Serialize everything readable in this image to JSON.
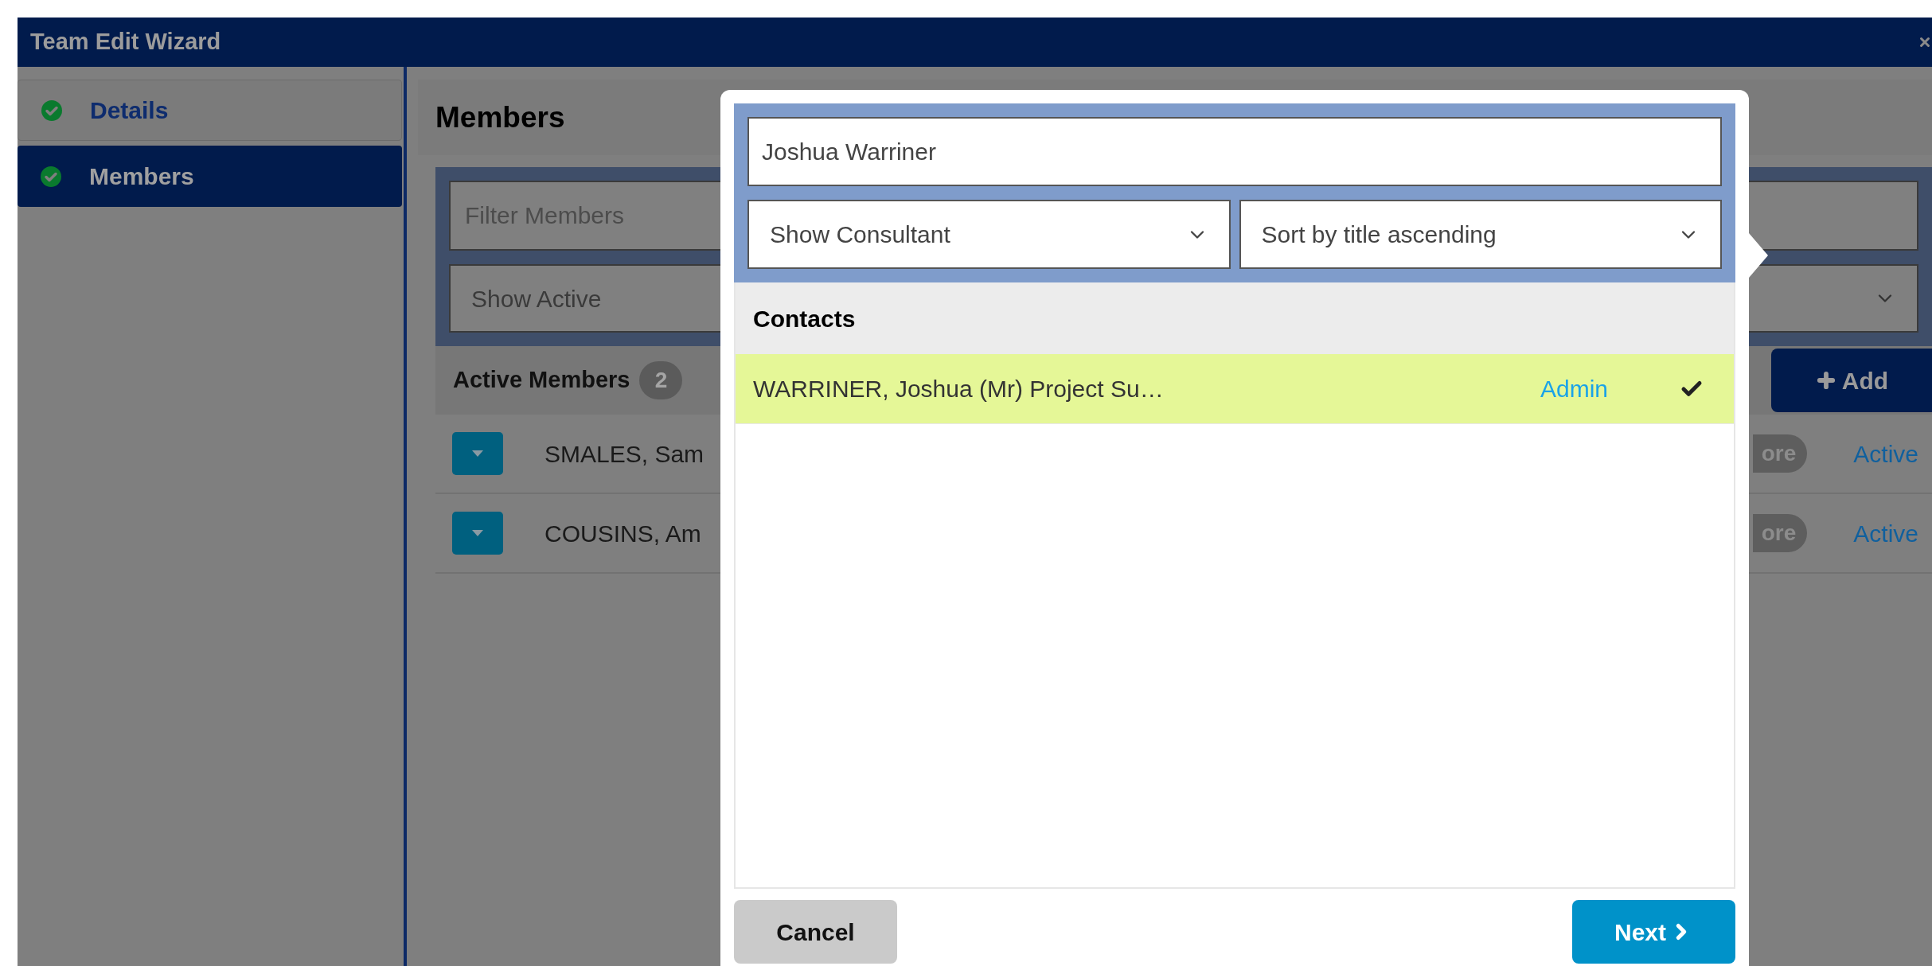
{
  "window": {
    "title": "Team Edit Wizard"
  },
  "steps": [
    {
      "label": "Details",
      "selected": false,
      "completed": true
    },
    {
      "label": "Members",
      "selected": true,
      "completed": true
    }
  ],
  "members_panel": {
    "title": "Members",
    "filter": {
      "placeholder": "Filter Members"
    },
    "status_select": {
      "value": "Show Active"
    },
    "list_header": {
      "label": "Active Members",
      "count": "2"
    },
    "add_button": "Add",
    "rows": [
      {
        "name": "SMALES, Sam",
        "tag": "ore",
        "status": "Active"
      },
      {
        "name": "COUSINS, Am",
        "tag": "ore",
        "status": "Active"
      }
    ]
  },
  "picker": {
    "search": {
      "value": "Joshua Warriner"
    },
    "type_select": {
      "value": "Show Consultant"
    },
    "sort_select": {
      "value": "Sort by title ascending"
    },
    "section_title": "Contacts",
    "results": [
      {
        "name": "WARRINER, Joshua (Mr) Project Su…",
        "role": "Admin",
        "selected": true
      }
    ],
    "cancel": "Cancel",
    "next": "Next"
  }
}
